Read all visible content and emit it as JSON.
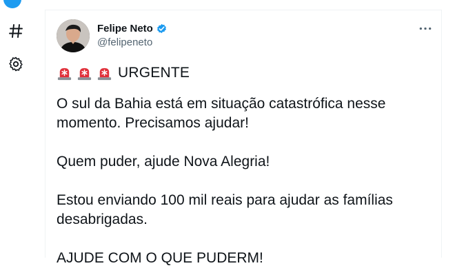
{
  "author": {
    "name": "Felipe Neto",
    "handle": "@felipeneto",
    "verified": true
  },
  "tweet": {
    "headline_emoji": [
      "siren",
      "siren",
      "siren"
    ],
    "headline": "URGENTE",
    "paragraphs": [
      "O sul da Bahia está em situação catastrófica nesse momento. Precisamos ajudar!",
      "Quem puder, ajude Nova Alegria!",
      "Estou enviando 100 mil reais para ajudar as famílias desabrigadas."
    ],
    "cut_line": "AJUDE COM O QUE PUDERM!"
  },
  "icons": {
    "rail": [
      "hashtag-icon",
      "gear-icon"
    ],
    "menu": "more-icon"
  },
  "colors": {
    "brand": "#1d9bf0",
    "text": "#0f1419",
    "muted": "#536471",
    "siren_red": "#e0303a"
  }
}
